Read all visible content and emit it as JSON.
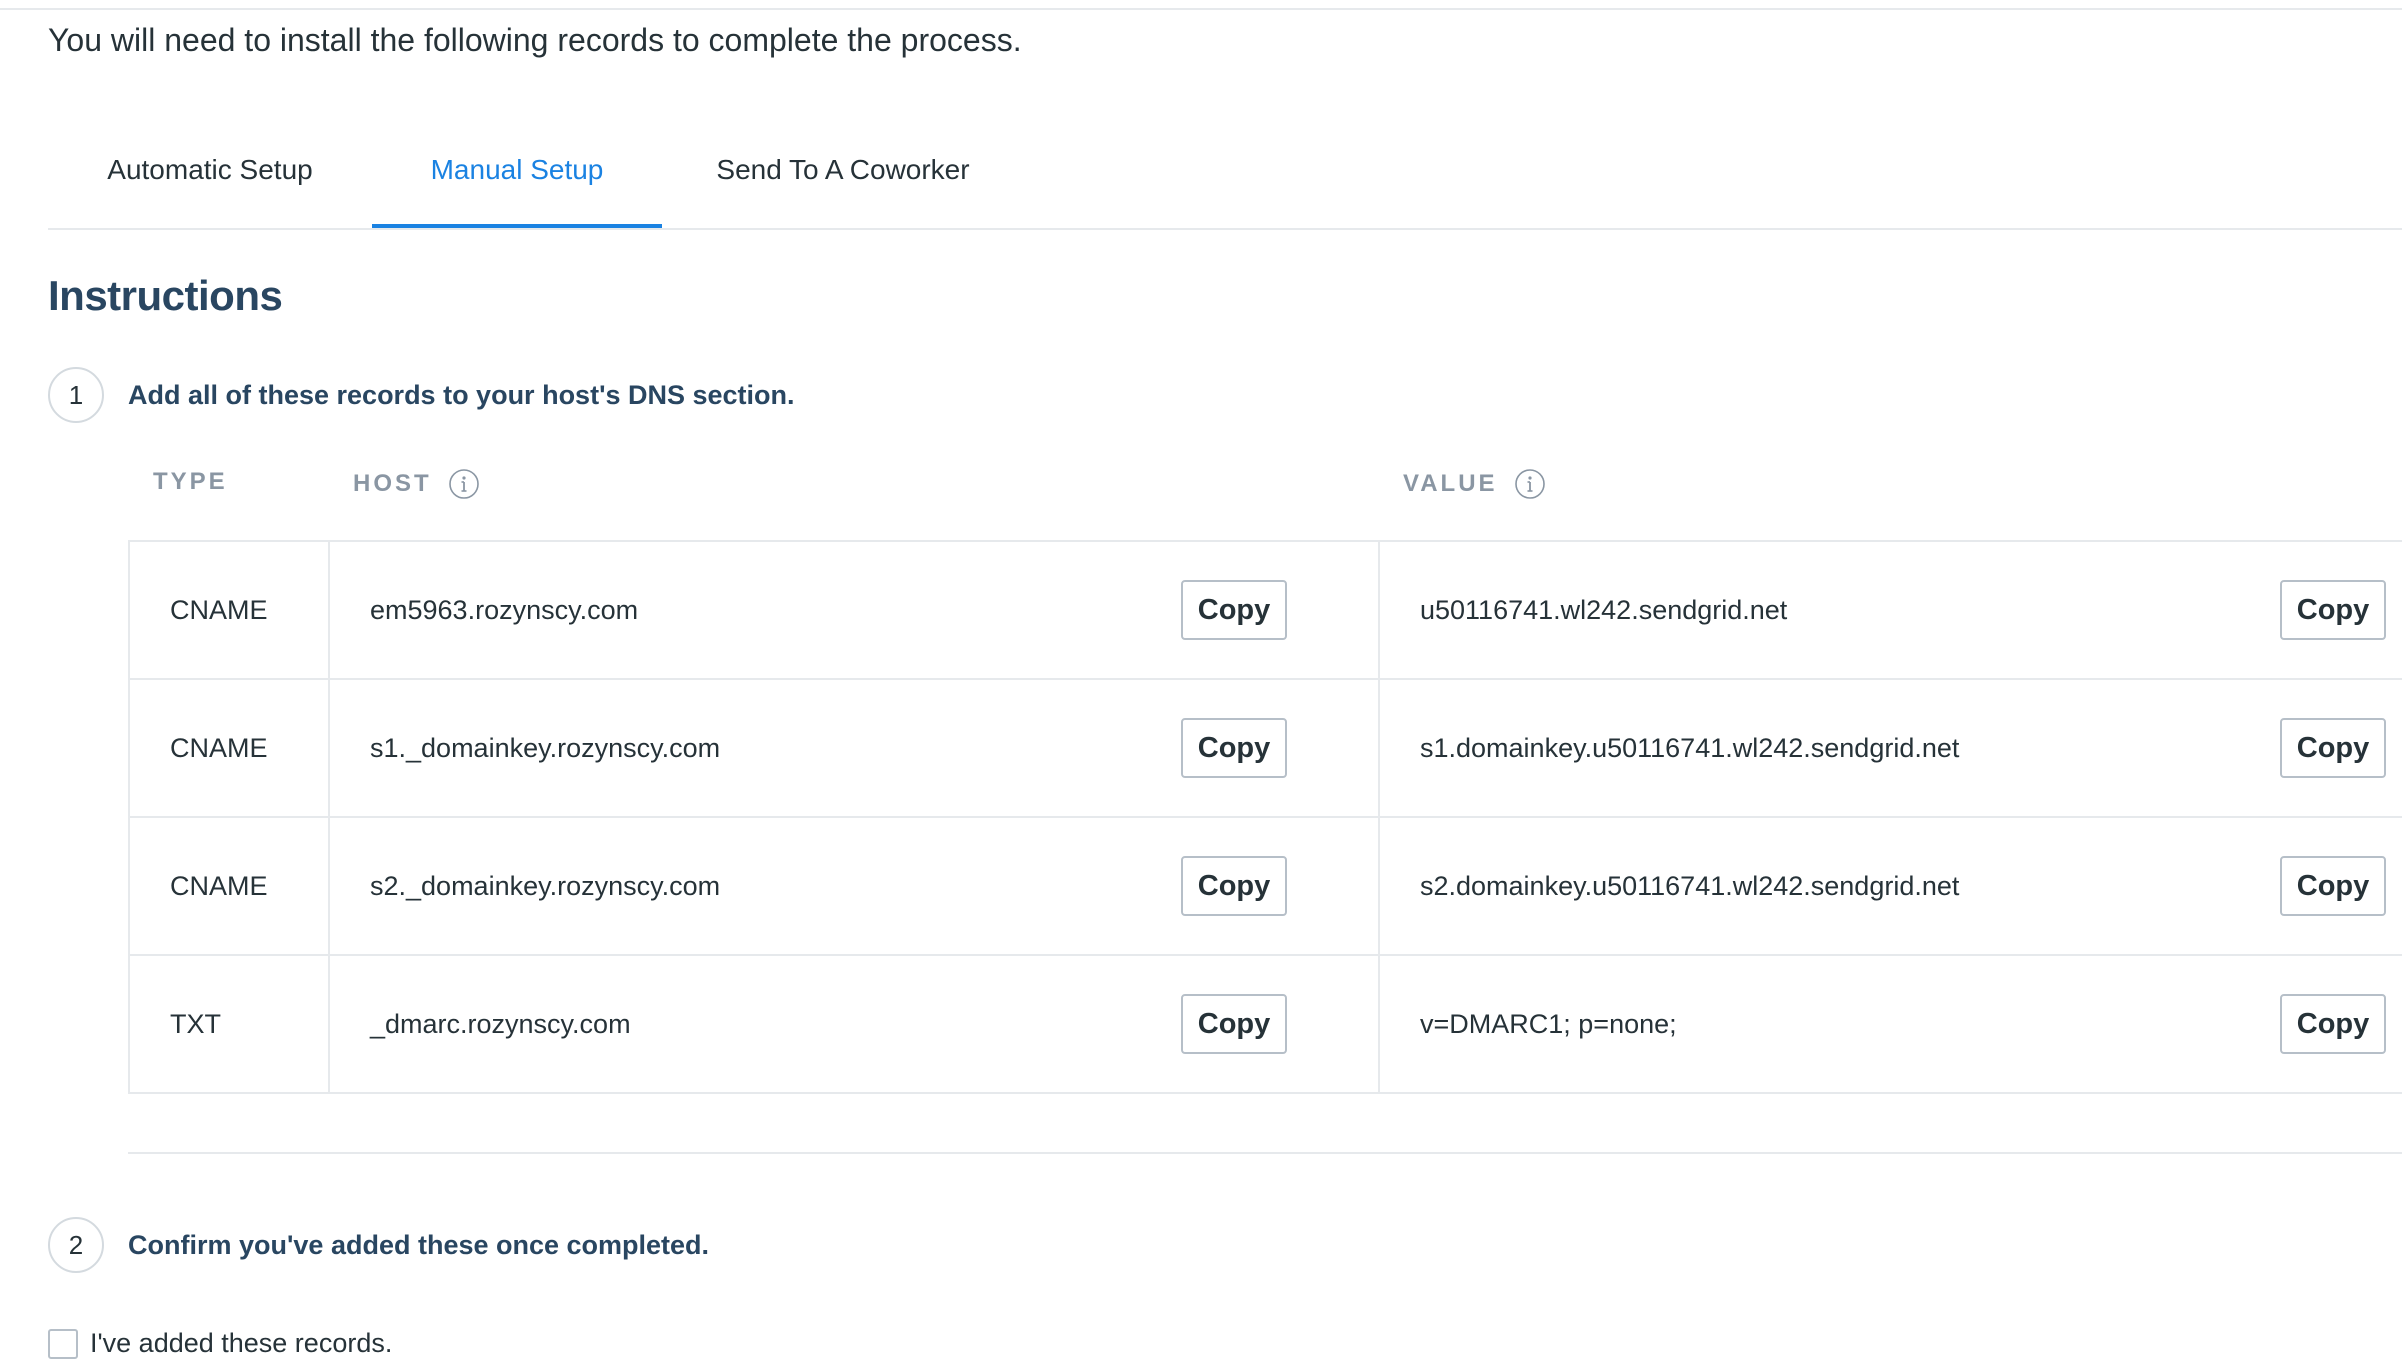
{
  "intro_text": "You will need to install the following records to complete the process.",
  "tabs": [
    {
      "label": "Automatic Setup",
      "active": false
    },
    {
      "label": "Manual Setup",
      "active": true
    },
    {
      "label": "Send To A Coworker",
      "active": false
    }
  ],
  "instructions": {
    "title": "Instructions",
    "steps": [
      {
        "number": "1",
        "text": "Add all of these records to your host's DNS section."
      },
      {
        "number": "2",
        "text": "Confirm you've added these once completed."
      }
    ]
  },
  "table": {
    "columns": {
      "type": "TYPE",
      "host": "HOST",
      "value": "VALUE"
    },
    "copy_label": "Copy",
    "rows": [
      {
        "type": "CNAME",
        "host": "em5963.rozynscy.com",
        "value": "u50116741.wl242.sendgrid.net"
      },
      {
        "type": "CNAME",
        "host": "s1._domainkey.rozynscy.com",
        "value": "s1.domainkey.u50116741.wl242.sendgrid.net"
      },
      {
        "type": "CNAME",
        "host": "s2._domainkey.rozynscy.com",
        "value": "s2.domainkey.u50116741.wl242.sendgrid.net"
      },
      {
        "type": "TXT",
        "host": "_dmarc.rozynscy.com",
        "value": "v=DMARC1; p=none;"
      }
    ]
  },
  "confirm": {
    "checkbox_label": "I've added these records.",
    "checked": false
  },
  "colors": {
    "accent": "#1a82e2",
    "heading": "#294661",
    "text": "#263238",
    "muted": "#8a96a3",
    "border": "#e6e9ec"
  },
  "icons": {
    "info": "info-icon"
  }
}
